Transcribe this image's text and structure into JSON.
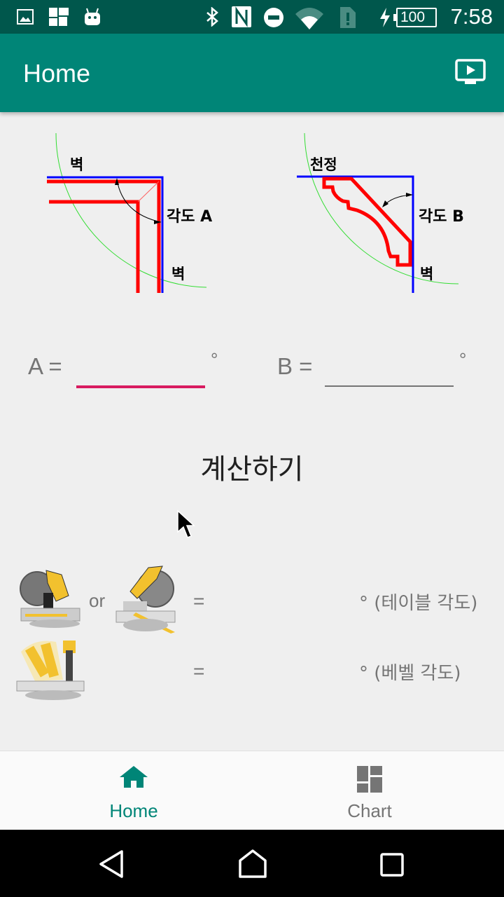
{
  "status_bar": {
    "time": "7:58",
    "battery": "100",
    "left_icons": [
      "image-icon",
      "puzzle-icon",
      "android-icon"
    ],
    "right_icons": [
      "bluetooth-icon",
      "nfc-icon",
      "do-not-disturb-icon",
      "wifi-icon",
      "sim-alert-icon",
      "charging-icon",
      "battery-icon"
    ]
  },
  "app_bar": {
    "title": "Home",
    "action_icon": "cast-icon"
  },
  "diagrams": {
    "a": {
      "wall_top": "벽",
      "wall_right": "벽",
      "angle_label": "각도 A"
    },
    "b": {
      "ceiling": "천정",
      "wall_right": "벽",
      "angle_label": "각도 B"
    }
  },
  "fields": {
    "a": {
      "label": "A =",
      "value": "",
      "unit": "°",
      "focused": true
    },
    "b": {
      "label": "B =",
      "value": "",
      "unit": "°",
      "focused": false
    }
  },
  "calculate_button": "계산하기",
  "results": {
    "or_label": "or",
    "table": {
      "equals": "=",
      "value": "",
      "suffix": "° (테이블 각도)"
    },
    "bevel": {
      "equals": "=",
      "value": "",
      "suffix": "° (베벨 각도)"
    }
  },
  "bottom_nav": {
    "items": [
      {
        "label": "Home",
        "icon": "home-icon",
        "active": true
      },
      {
        "label": "Chart",
        "icon": "dashboard-icon",
        "active": false
      }
    ]
  },
  "colors": {
    "primary": "#008577",
    "primary_dark": "#00574c",
    "accent": "#d81b60",
    "inactive": "#757575"
  }
}
